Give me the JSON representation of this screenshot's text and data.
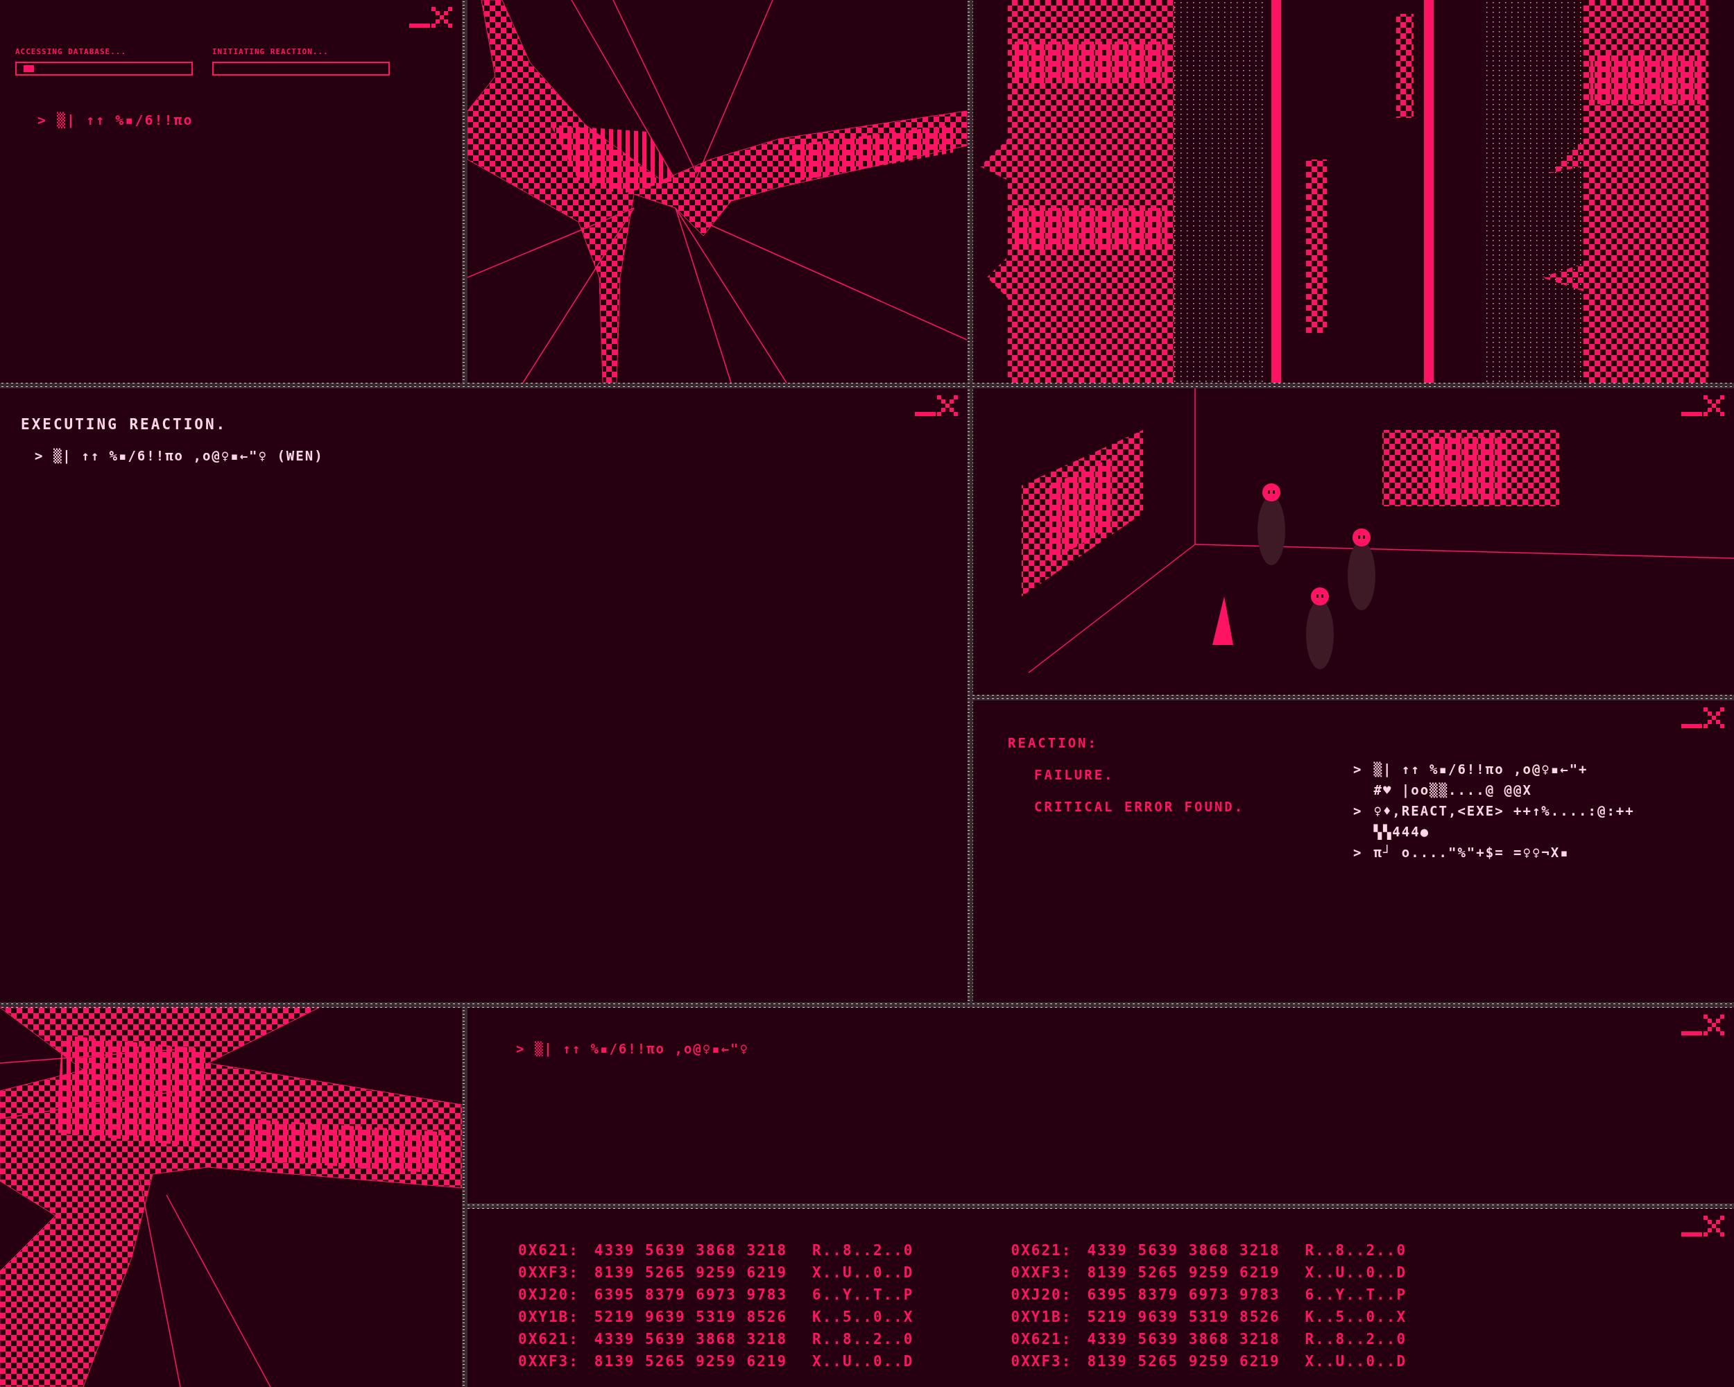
{
  "progress_window": {
    "bars": [
      {
        "label": "ACCESSING DATABASE...",
        "level": 0.06
      },
      {
        "label": "INITIATING REACTION...",
        "level": 0
      }
    ],
    "prompt": "> ▒| ↑↑ %▪/6!!πo"
  },
  "console_window": {
    "title": "EXECUTING REACTION.",
    "prompt": "> ▒| ↑↑ %▪/6!!πo ,o@♀▪←\"♀ (WEN)"
  },
  "reaction_window": {
    "heading": "REACTION:",
    "messages": [
      "FAILURE.",
      "CRITICAL ERROR FOUND."
    ],
    "log": [
      {
        "marker": ">",
        "lines": [
          "▒| ↑↑ %▪/6!!πo ,o@♀▪←\"+",
          "#♥ |oo▒▒....@ @@X"
        ]
      },
      {
        "marker": ">",
        "lines": [
          "♀♦,REACT,<EXE> ++↑%....:@:++",
          "▚▚444●"
        ]
      },
      {
        "marker": ">",
        "lines": [
          "π┘ o....\"%\"+$= =♀♀¬X▪"
        ]
      }
    ]
  },
  "prompt_window": {
    "prompt": "> ▒| ↑↑ %▪/6!!πo ,o@♀▪←\"♀"
  },
  "hex_dump": {
    "columns": [
      {
        "rows": [
          {
            "address": "0X621:",
            "words": "4339 5639 3868 3218",
            "ascii": "R..8..2..0"
          },
          {
            "address": "0XXF3:",
            "words": "8139 5265 9259 6219",
            "ascii": "X..U..0..D"
          },
          {
            "address": "0XJ20:",
            "words": "6395 8379 6973 9783",
            "ascii": "6..Y..T..P"
          },
          {
            "address": "0XY1B:",
            "words": "5219 9639 5319 8526",
            "ascii": "K..5..0..X"
          },
          {
            "address": "0X621:",
            "words": "4339 5639 3868 3218",
            "ascii": "R..8..2..0"
          },
          {
            "address": "0XXF3:",
            "words": "8139 5265 9259 6219",
            "ascii": "X..U..0..D"
          }
        ]
      },
      {
        "rows": [
          {
            "address": "0X621:",
            "words": "4339 5639 3868 3218",
            "ascii": "R..8..2..0"
          },
          {
            "address": "0XXF3:",
            "words": "8139 5265 9259 6219",
            "ascii": "X..U..0..D"
          },
          {
            "address": "0XJ20:",
            "words": "6395 8379 6973 9783",
            "ascii": "6..Y..T..P"
          },
          {
            "address": "0XY1B:",
            "words": "5219 9639 5319 8526",
            "ascii": "K..5..0..X"
          },
          {
            "address": "0X621:",
            "words": "4339 5639 3868 3218",
            "ascii": "R..8..2..0"
          },
          {
            "address": "0XXF3:",
            "words": "8139 5265 9259 6219",
            "ascii": "X..U..0..D"
          }
        ]
      }
    ]
  }
}
